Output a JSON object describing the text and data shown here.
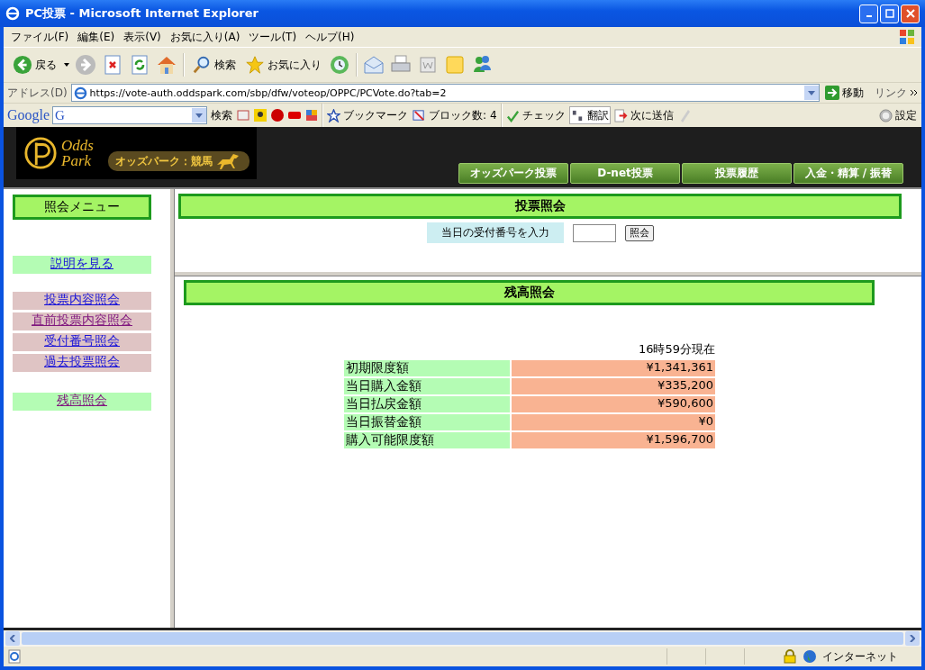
{
  "window": {
    "title": "PC投票 - Microsoft Internet Explorer"
  },
  "menu_bar": [
    "ファイル(F)",
    "編集(E)",
    "表示(V)",
    "お気に入り(A)",
    "ツール(T)",
    "ヘルプ(H)"
  ],
  "toolbar": {
    "back": "戻る",
    "search": "検索",
    "favorites": "お気に入り"
  },
  "address_bar": {
    "label": "アドレス(D)",
    "url": "https://vote-auth.oddspark.com/sbp/dfw/voteop/OPPC/PCVote.do?tab=2",
    "go": "移動",
    "links": "リンク"
  },
  "google_bar": {
    "brand": "Google",
    "engine_letter": "G",
    "search": "検索",
    "bookmarks": "ブックマーク",
    "blocked": "ブロック数: 4",
    "check": "チェック",
    "translate": "翻訳",
    "send_to": "次に送信",
    "settings": "設定"
  },
  "site_header": {
    "logo_top": "Odds",
    "logo_bottom": "Park",
    "tagline": "オッズパーク：競馬",
    "nav": [
      "オッズパーク投票",
      "D-net投票",
      "投票履歴",
      "入金・精算 / 振替"
    ]
  },
  "side_menu": {
    "title": "照会メニュー",
    "items": [
      {
        "label": "説明を見る",
        "kind": "help",
        "visited": false
      },
      {
        "label": "投票内容照会",
        "kind": "inquiry",
        "visited": false
      },
      {
        "label": "直前投票内容照会",
        "kind": "inquiry",
        "visited": true
      },
      {
        "label": "受付番号照会",
        "kind": "inquiry",
        "visited": false
      },
      {
        "label": "過去投票照会",
        "kind": "inquiry",
        "visited": false
      },
      {
        "label": "残高照会",
        "kind": "balance",
        "visited": true
      }
    ]
  },
  "vote_inquiry": {
    "title": "投票照会",
    "prompt": "当日の受付番号を入力",
    "button": "照会"
  },
  "balance": {
    "title": "残高照会",
    "as_of": "16時59分現在",
    "rows": [
      {
        "label": "初期限度額",
        "value": "¥1,341,361"
      },
      {
        "label": "当日購入金額",
        "value": "¥335,200"
      },
      {
        "label": "当日払戻金額",
        "value": "¥590,600"
      },
      {
        "label": "当日振替金額",
        "value": "¥0"
      },
      {
        "label": "購入可能限度額",
        "value": "¥1,596,700"
      }
    ]
  },
  "status_bar": {
    "zone": "インターネット"
  }
}
